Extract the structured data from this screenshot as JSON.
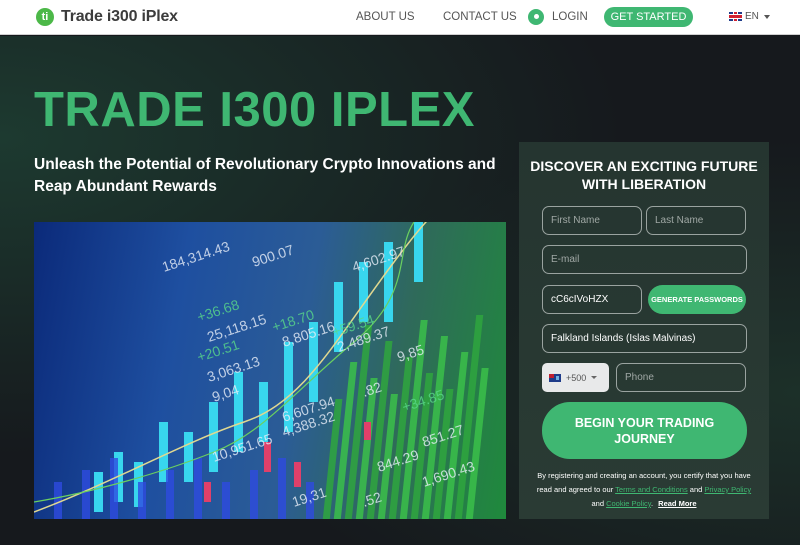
{
  "header": {
    "brand": "Trade i300 iPlex",
    "logo_icon": "ti-monogram-icon",
    "nav": [
      {
        "label": "ABOUT US"
      },
      {
        "label": "CONTACT US"
      }
    ],
    "login_label": "LOGIN",
    "login_icon": "user-icon",
    "get_started_label": "GET STARTED",
    "language": {
      "code": "EN",
      "flag": "uk-flag-icon"
    }
  },
  "hero": {
    "title": "TRADE I300 IPLEX",
    "subtitle": "Unleash the Potential of Revolutionary Crypto Innovations and Reap Abundant Rewards",
    "image_description": "stock market ticker board with candlestick chart",
    "ticker_values": [
      "184,314.43",
      "900.07",
      "4,602.97",
      "+36.68",
      "25,118.15",
      "+18.70",
      "8,805.16",
      "+20.51",
      "3,063.13",
      "+59.54",
      "2,489.37",
      "9,04",
      ".82",
      "6,607.94",
      "4,388.32",
      "+34.85",
      "10,951.65",
      "844.29",
      "851.27",
      "1,690.43",
      "19,31",
      ".52",
      "9,85"
    ]
  },
  "form": {
    "title": "DISCOVER AN EXCITING FUTURE WITH LIBERATION",
    "first_name": {
      "placeholder": "First Name",
      "value": ""
    },
    "last_name": {
      "placeholder": "Last Name",
      "value": ""
    },
    "email": {
      "placeholder": "E-mail",
      "value": ""
    },
    "password": {
      "value": "cC6cIVoHZX"
    },
    "generate_label": "GENERATE PASSWORDS",
    "country": {
      "value": "Falkland Islands (Islas Malvinas)"
    },
    "phone_code": {
      "value": "+500",
      "flag": "falkland-flag-icon"
    },
    "phone": {
      "placeholder": "Phone",
      "value": ""
    },
    "submit_label": "BEGIN YOUR TRADING JOURNEY",
    "disclaimer": {
      "prefix": "By registering and creating an account, you certify that you have read and agreed to our",
      "terms": "Terms and Conditions",
      "and1": "and",
      "privacy": "Privacy Policy",
      "and2": "and",
      "cookie": "Cookie Policy",
      "period": ".",
      "read_more": "Read More"
    }
  },
  "colors": {
    "accent": "#3fb772",
    "logo_green": "#4cb848",
    "header_bg": "#ffffff",
    "hero_bg": "#16191d",
    "panel_bg": "#253530"
  }
}
